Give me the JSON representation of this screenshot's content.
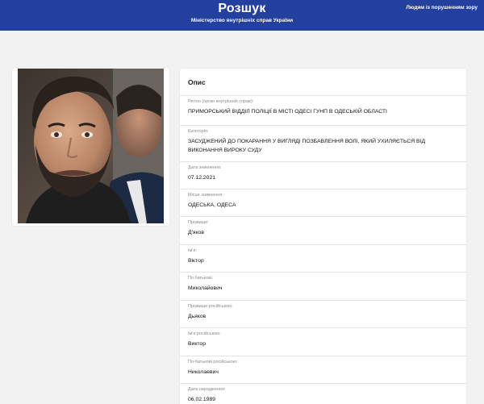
{
  "header": {
    "title": "Розшук",
    "subtitle": "Міністерство внутрішніх справ України",
    "accessibility_link": "Людям із порушенням зору",
    "background_color": "#24409e"
  },
  "photo": {
    "description": "portrait-photo"
  },
  "info": {
    "title": "Опис",
    "fields": [
      {
        "label": "Регіон (орган внутрішніх справ):",
        "value": "ПРИМОРСЬКИЙ ВІДДІЛ ПОЛІЦІЇ В МІСТІ ОДЕСІ ГУНП В ОДЕСЬКІЙ ОБЛАСТІ"
      },
      {
        "label": "Категорія:",
        "value": "ЗАСУДЖЕНИЙ ДО ПОКАРАННЯ У ВИГЛЯДІ ПОЗБАВЛЕННЯ ВОЛІ, ЯКИЙ УХИЛЯЄТЬСЯ ВІД ВИКОНАННЯ ВИРОКУ СУДУ"
      },
      {
        "label": "Дата зникнення:",
        "value": "07.12.2021"
      },
      {
        "label": "Місце зникнення:",
        "value": "ОДЕСЬКА, ОДЕСА"
      },
      {
        "label": "Прізвище:",
        "value": "Д'яков"
      },
      {
        "label": "Ім'я:",
        "value": "Віктор"
      },
      {
        "label": "По батькові:",
        "value": "Миколайович"
      },
      {
        "label": "Прізвище російською:",
        "value": "Дьяков"
      },
      {
        "label": "Ім'я російською:",
        "value": "Виктор"
      },
      {
        "label": "По-батькові російською:",
        "value": "Николаевич"
      },
      {
        "label": "Дата народження:",
        "value": "06.02.1989"
      }
    ]
  }
}
